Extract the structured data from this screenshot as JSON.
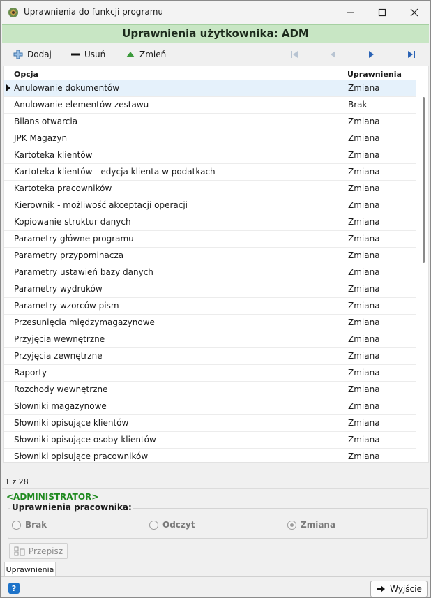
{
  "window": {
    "title": "Uprawnienia do funkcji programu"
  },
  "header": {
    "title": "Uprawnienia użytkownika: ADM"
  },
  "toolbar": {
    "add_label": "Dodaj",
    "delete_label": "Usuń",
    "edit_label": "Zmień"
  },
  "grid": {
    "columns": [
      "Opcja",
      "Uprawnienia"
    ],
    "rows": [
      {
        "option": "Anulowanie dokumentów",
        "permission": "Zmiana"
      },
      {
        "option": "Anulowanie elementów zestawu",
        "permission": "Brak"
      },
      {
        "option": "Bilans otwarcia",
        "permission": "Zmiana"
      },
      {
        "option": "JPK Magazyn",
        "permission": "Zmiana"
      },
      {
        "option": "Kartoteka klientów",
        "permission": "Zmiana"
      },
      {
        "option": "Kartoteka klientów - edycja klienta w podatkach",
        "permission": "Zmiana"
      },
      {
        "option": "Kartoteka pracowników",
        "permission": "Zmiana"
      },
      {
        "option": "Kierownik - możliwość akceptacji operacji",
        "permission": "Zmiana"
      },
      {
        "option": "Kopiowanie struktur danych",
        "permission": "Zmiana"
      },
      {
        "option": "Parametry główne programu",
        "permission": "Zmiana"
      },
      {
        "option": "Parametry przypominacza",
        "permission": "Zmiana"
      },
      {
        "option": "Parametry ustawień bazy danych",
        "permission": "Zmiana"
      },
      {
        "option": "Parametry wydruków",
        "permission": "Zmiana"
      },
      {
        "option": "Parametry wzorców pism",
        "permission": "Zmiana"
      },
      {
        "option": "Przesunięcia międzymagazynowe",
        "permission": "Zmiana"
      },
      {
        "option": "Przyjęcia wewnętrzne",
        "permission": "Zmiana"
      },
      {
        "option": "Przyjęcia zewnętrzne",
        "permission": "Zmiana"
      },
      {
        "option": "Raporty",
        "permission": "Zmiana"
      },
      {
        "option": "Rozchody wewnętrzne",
        "permission": "Zmiana"
      },
      {
        "option": "Słowniki magazynowe",
        "permission": "Zmiana"
      },
      {
        "option": "Słowniki opisujące klientów",
        "permission": "Zmiana"
      },
      {
        "option": "Słowniki opisujące osoby klientów",
        "permission": "Zmiana"
      },
      {
        "option": "Słowniki opisujące pracowników",
        "permission": "Zmiana"
      }
    ]
  },
  "status": {
    "record_counter": "1 z 28"
  },
  "user_role": "<ADMINISTRATOR>",
  "employee_permissions": {
    "legend": "Uprawnienia pracownika:",
    "options": [
      "Brak",
      "Odczyt",
      "Zmiana"
    ],
    "selected": "Zmiana"
  },
  "actions": {
    "copy_label": "Przepisz",
    "exit_label": "Wyjście"
  },
  "tabs": [
    "Uprawnienia"
  ],
  "colors": {
    "banner": "#c8e6c4",
    "admin_text": "#1f8a1f",
    "selected_row": "#e5f1fb"
  }
}
